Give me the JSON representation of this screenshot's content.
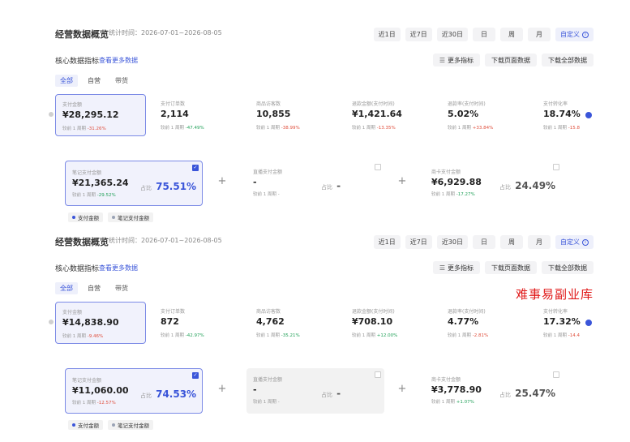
{
  "panels": [
    {
      "title": "经营数据概览",
      "stat_time": "统计时间：2026-07-01~2026-08-05",
      "ranges": [
        "近1日",
        "近7日",
        "近30日",
        "日",
        "周",
        "月",
        "自定义"
      ],
      "active_range": 6,
      "section_title": "核心数据指标",
      "section_link": "查看更多数据",
      "actions": [
        "更多指标",
        "下载页面数据",
        "下载全部数据"
      ],
      "filters": [
        "全部",
        "自营",
        "带货"
      ],
      "metrics": [
        {
          "label": "支付金额",
          "value": "¥28,295.12",
          "compare": "较前 1 周期",
          "delta": "-31.26%",
          "dir": "down"
        },
        {
          "label": "支付订单数",
          "value": "2,114",
          "compare": "较前 1 周期",
          "delta": "-47.49%",
          "dir": "up"
        },
        {
          "label": "商品访客数",
          "value": "10,855",
          "compare": "较前 1 周期",
          "delta": "-38.99%",
          "dir": "down"
        },
        {
          "label": "退款金额(支付时间)",
          "value": "¥1,421.64",
          "compare": "较前 1 周期",
          "delta": "-13.35%",
          "dir": "down"
        },
        {
          "label": "退款率(支付时间)",
          "value": "5.02%",
          "compare": "较前 1 周期",
          "delta": "+33.84%",
          "dir": "down"
        },
        {
          "label": "支付转化率",
          "value": "18.74%",
          "compare": "较前 1 周期",
          "delta": "-15.8",
          "dir": "down"
        }
      ],
      "subcards": [
        {
          "label": "笔记支付金额",
          "value": "¥21,365.24",
          "compare": "较前 1 周期",
          "delta": "-29.52%",
          "dir": "up",
          "share_label": "占比",
          "share": "75.51%",
          "style": "selected"
        },
        {
          "label": "直播支付金额",
          "value": "-",
          "compare": "较前 1 周期",
          "delta": "-",
          "dir": "none",
          "share_label": "占比",
          "share": "-",
          "style": "plain"
        },
        {
          "label": "商卡支付金额",
          "value": "¥6,929.88",
          "compare": "较前 1 周期",
          "delta": "-17.27%",
          "dir": "up",
          "share_label": "占比",
          "share": "24.49%",
          "style": "plain"
        }
      ],
      "legend": [
        "支付金额",
        "笔记支付金额"
      ]
    },
    {
      "title": "经营数据概览",
      "stat_time": "统计时间：2026-07-01~2026-08-05",
      "ranges": [
        "近1日",
        "近7日",
        "近30日",
        "日",
        "周",
        "月",
        "自定义"
      ],
      "active_range": 6,
      "section_title": "核心数据指标",
      "section_link": "查看更多数据",
      "actions": [
        "更多指标",
        "下载页面数据",
        "下载全部数据"
      ],
      "filters": [
        "全部",
        "自营",
        "带货"
      ],
      "metrics": [
        {
          "label": "支付金额",
          "value": "¥14,838.90",
          "compare": "较前 1 周期",
          "delta": "-9.46%",
          "dir": "down"
        },
        {
          "label": "支付订单数",
          "value": "872",
          "compare": "较前 1 周期",
          "delta": "-42.97%",
          "dir": "up"
        },
        {
          "label": "商品访客数",
          "value": "4,762",
          "compare": "较前 1 周期",
          "delta": "-35.21%",
          "dir": "up"
        },
        {
          "label": "退款金额(支付时间)",
          "value": "¥708.10",
          "compare": "较前 1 周期",
          "delta": "+12.00%",
          "dir": "up"
        },
        {
          "label": "退款率(支付时间)",
          "value": "4.77%",
          "compare": "较前 1 周期",
          "delta": "-2.81%",
          "dir": "down"
        },
        {
          "label": "支付转化率",
          "value": "17.32%",
          "compare": "较前 1 周期",
          "delta": "-14.4",
          "dir": "down"
        }
      ],
      "subcards": [
        {
          "label": "笔记支付金额",
          "value": "¥11,060.00",
          "compare": "较前 1 周期",
          "delta": "-12.57%",
          "dir": "down",
          "share_label": "占比",
          "share": "74.53%",
          "style": "selected"
        },
        {
          "label": "直播支付金额",
          "value": "-",
          "compare": "较前 1 周期",
          "delta": "-",
          "dir": "none",
          "share_label": "占比",
          "share": "-",
          "style": "muted"
        },
        {
          "label": "商卡支付金额",
          "value": "¥3,778.90",
          "compare": "较前 1 周期",
          "delta": "+1.07%",
          "dir": "up",
          "share_label": "占比",
          "share": "25.47%",
          "style": "plain"
        }
      ],
      "legend": [
        "支付金额",
        "笔记支付金额"
      ]
    }
  ],
  "watermark": "难事易副业库",
  "colors": {
    "accent": "#3a55d9",
    "up": "#23a15a",
    "down": "#e0503e",
    "watermark": "#e01818",
    "legend_primary": "#3a55d9",
    "legend_secondary": "#9aa3b5"
  }
}
